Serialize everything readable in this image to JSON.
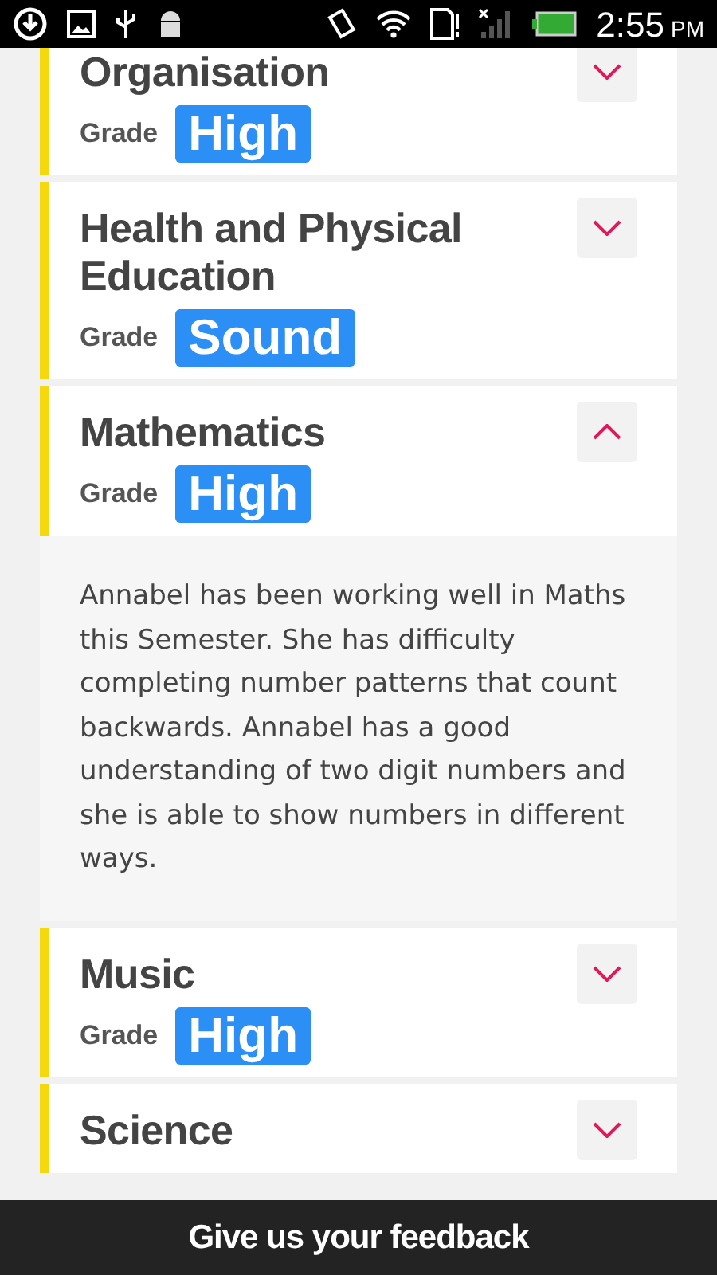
{
  "status_bar": {
    "time": "2:55",
    "meridiem": "PM"
  },
  "subjects": [
    {
      "title": "Organisation",
      "grade_label": "Grade",
      "grade": "High",
      "expanded": false
    },
    {
      "title": "Health and Physical Education",
      "grade_label": "Grade",
      "grade": "Sound",
      "expanded": false
    },
    {
      "title": "Mathematics",
      "grade_label": "Grade",
      "grade": "High",
      "expanded": true,
      "comment": "Annabel has been working well in Maths this Semester. She has difficulty completing number patterns that count backwards. Annabel has a good understanding of two digit numbers and she is able to show numbers in different ways."
    },
    {
      "title": "Music",
      "grade_label": "Grade",
      "grade": "High",
      "expanded": false
    },
    {
      "title": "Science",
      "expanded": false
    }
  ],
  "footer": {
    "label": "Give us your feedback"
  }
}
